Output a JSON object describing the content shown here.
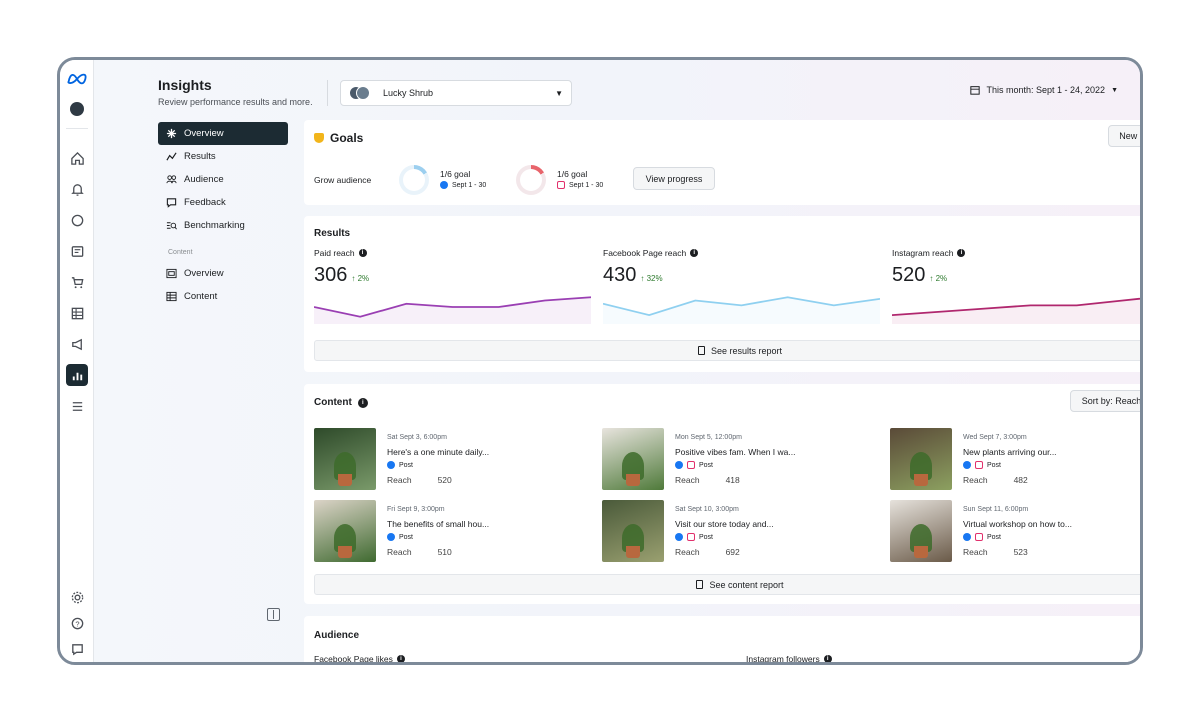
{
  "app": {
    "title": "Insights",
    "subtitle": "Review performance results and more."
  },
  "account_selector": {
    "name": "Lucky Shrub"
  },
  "date_range": {
    "label": "This month: Sept 1 - 24, 2022"
  },
  "nav": {
    "items": [
      {
        "label": "Overview",
        "icon": "overview-icon",
        "active": true
      },
      {
        "label": "Results",
        "icon": "results-icon"
      },
      {
        "label": "Audience",
        "icon": "audience-icon"
      },
      {
        "label": "Feedback",
        "icon": "feedback-icon"
      },
      {
        "label": "Benchmarking",
        "icon": "benchmarking-icon"
      }
    ],
    "content_section_label": "Content",
    "content_items": [
      {
        "label": "Overview",
        "icon": "content-overview-icon"
      },
      {
        "label": "Content",
        "icon": "content-table-icon"
      }
    ]
  },
  "goals": {
    "title": "Goals",
    "new_goal_label": "New goal",
    "row_label": "Grow audience",
    "items": [
      {
        "progress": "1/6 goal",
        "dates": "Sept 1 - 30",
        "platform": "facebook",
        "color": "#a8d5f0"
      },
      {
        "progress": "1/6 goal",
        "dates": "Sept 1 - 30",
        "platform": "instagram",
        "color": "#e8646b"
      }
    ],
    "view_progress_label": "View progress"
  },
  "results": {
    "title": "Results",
    "metrics": [
      {
        "label": "Paid reach",
        "value": "306",
        "change": "2%",
        "color": "#9a3fb3",
        "series": [
          8,
          2,
          10,
          8,
          8,
          12,
          14
        ]
      },
      {
        "label": "Facebook Page reach",
        "value": "430",
        "change": "32%",
        "color": "#8fd0f0",
        "series": [
          10,
          3,
          12,
          9,
          14,
          9,
          13
        ]
      },
      {
        "label": "Instagram reach",
        "value": "520",
        "change": "2%",
        "color": "#b0276e",
        "series": [
          3,
          5,
          7,
          9,
          9,
          12,
          15
        ]
      }
    ],
    "report_label": "See results report"
  },
  "content": {
    "title": "Content",
    "sort_label": "Sort by: Reach",
    "reach_label": "Reach",
    "type_label": "Post",
    "posts": [
      {
        "date": "Sat Sept 3, 6:00pm",
        "title": "Here's a one minute daily...",
        "reach": "520",
        "ig": false
      },
      {
        "date": "Mon Sept 5, 12:00pm",
        "title": "Positive vibes fam. When I wa...",
        "reach": "418",
        "ig": true
      },
      {
        "date": "Wed Sept 7, 3:00pm",
        "title": "New plants arriving our...",
        "reach": "482",
        "ig": true
      },
      {
        "date": "Fri Sept 9, 3:00pm",
        "title": "The benefits of small hou...",
        "reach": "510",
        "ig": false
      },
      {
        "date": "Sat Sept 10, 3:00pm",
        "title": "Visit our store today and...",
        "reach": "692",
        "ig": true
      },
      {
        "date": "Sun Sept 11, 6:00pm",
        "title": "Virtual workshop on how to...",
        "reach": "523",
        "ig": true
      }
    ],
    "report_label": "See content report"
  },
  "audience": {
    "title": "Audience",
    "facebook_label": "Facebook Page likes",
    "instagram_label": "Instagram followers"
  }
}
